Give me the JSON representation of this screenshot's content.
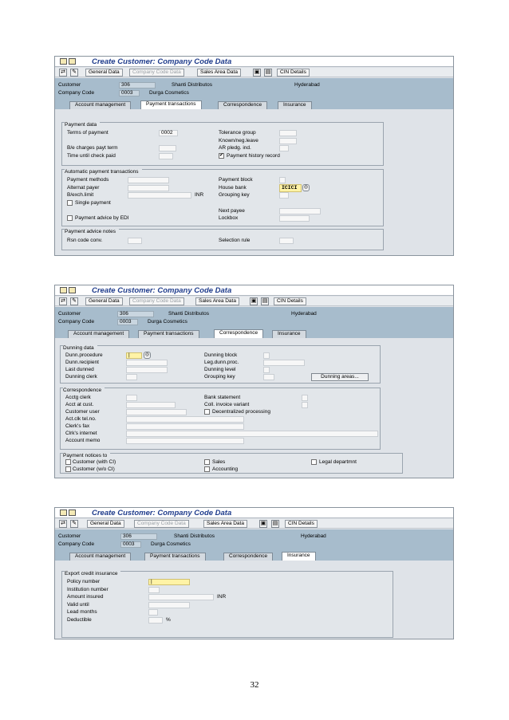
{
  "window_title": "Create Customer: Company Code Data",
  "toolbar": {
    "general_data": "General Data",
    "company_code_data": "Company Code Data",
    "sales_area_data": "Sales Area Data",
    "cin_details": "CIN Details"
  },
  "header": {
    "customer_label": "Customer",
    "customer_value": "306",
    "customer_name": "Shanti Distributos",
    "city": "Hyderabad",
    "company_code_label": "Company Code",
    "company_code_value": "0003",
    "company_name": "Durga Cosmetics"
  },
  "tabs": {
    "account_management": "Account management",
    "payment_transactions": "Payment transactions",
    "correspondence": "Correspondence",
    "insurance": "Insurance"
  },
  "screen1": {
    "payment_data": {
      "title": "Payment data",
      "terms_of_payment": "Terms of payment",
      "terms_value": "0002",
      "be_charges": "B/e charges payt term",
      "time_until_check_paid": "Time until check paid",
      "tolerance_group": "Tolerance group",
      "known_neg_leave": "Known/neg.leave",
      "ar_pledg_ind": "AR pledg. ind.",
      "payment_history_record": "Payment history record",
      "payment_history_checked": true
    },
    "auto_payment": {
      "title": "Automatic payment transactions",
      "payment_methods": "Payment methods",
      "alternat_payer": "Alternat payer",
      "b_exch_limit": "B/exch.limit",
      "currency": "INR",
      "single_payment": "Single payment",
      "payment_advice_edi": "Payment advice by EDI",
      "payment_block": "Payment block",
      "house_bank": "House bank",
      "house_bank_value": "ICICI",
      "grouping_key": "Grouping key",
      "next_payee": "Next payee",
      "lockbox": "Lockbox"
    },
    "advice_notes": {
      "title": "Payment advice notes",
      "rsn_code_conv": "Rsn code conv.",
      "selection_rule": "Selection rule"
    }
  },
  "screen2": {
    "dunning": {
      "title": "Dunning data",
      "dunn_procedure": "Dunn.procedure",
      "dunn_recipient": "Dunn.recipient",
      "last_dunned": "Last dunned",
      "dunning_clerk": "Dunning clerk",
      "dunning_block": "Dunning block",
      "leg_dunn_proc": "Leg.dunn.proc.",
      "dunning_level": "Dunning level",
      "grouping_key": "Grouping key",
      "dunning_areas": "Dunning areas..."
    },
    "correspondence": {
      "title": "Correspondence",
      "acctg_clerk": "Acctg clerk",
      "acct_at_cust": "Acct at cust.",
      "customer_user": "Customer user",
      "act_clk_tel": "Act.clk tel.no.",
      "clerks_fax": "Clerk's fax",
      "clrks_internet": "Clrk's internet",
      "account_memo": "Account memo",
      "bank_statement": "Bank statement",
      "coll_invoice_variant": "Coll. invoice variant",
      "decentralized_processing": "Decentralized processing"
    },
    "payment_notices": {
      "title": "Payment notices to",
      "customer_with_ci": "Customer (with CI)",
      "customer_wo_ci": "Customer (w/o CI)",
      "sales": "Sales",
      "accounting": "Accounting",
      "legal_department": "Legal departmnt"
    }
  },
  "screen3": {
    "export_credit": {
      "title": "Export credit insurance",
      "policy_number": "Policy number",
      "institution_number": "Institution number",
      "amount_insured": "Amount insured",
      "currency": "INR",
      "valid_until": "Valid until",
      "lead_months": "Lead months",
      "deductible": "Deductible",
      "percent": "%"
    }
  },
  "page_number": "32"
}
